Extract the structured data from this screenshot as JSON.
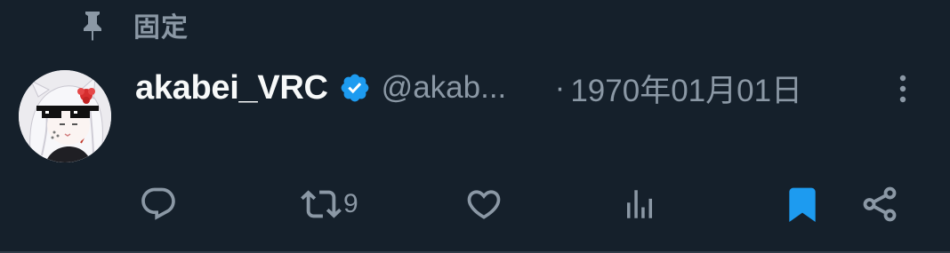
{
  "pinned": {
    "label": "固定",
    "icon": "pin-icon"
  },
  "author": {
    "display_name": "akabei_VRC",
    "handle": "@akab...",
    "verified": true,
    "verified_color": "#1d9bf0",
    "avatar_icon": "avatar-image"
  },
  "separator": "·",
  "timestamp": "1970年01月01日",
  "menu_icon": "more-vertical-icon",
  "actions": {
    "reply": {
      "icon": "reply-icon",
      "count": ""
    },
    "repost": {
      "icon": "repost-icon",
      "count": "9"
    },
    "like": {
      "icon": "heart-icon",
      "count": ""
    },
    "views": {
      "icon": "analytics-icon",
      "count": ""
    },
    "bookmark": {
      "icon": "bookmark-icon",
      "active": true,
      "color": "#1d9bf0"
    },
    "share": {
      "icon": "share-icon"
    }
  },
  "colors": {
    "background": "#15202b",
    "primary_text": "#f7f9f9",
    "secondary_text": "#8b98a5",
    "accent": "#1d9bf0"
  }
}
